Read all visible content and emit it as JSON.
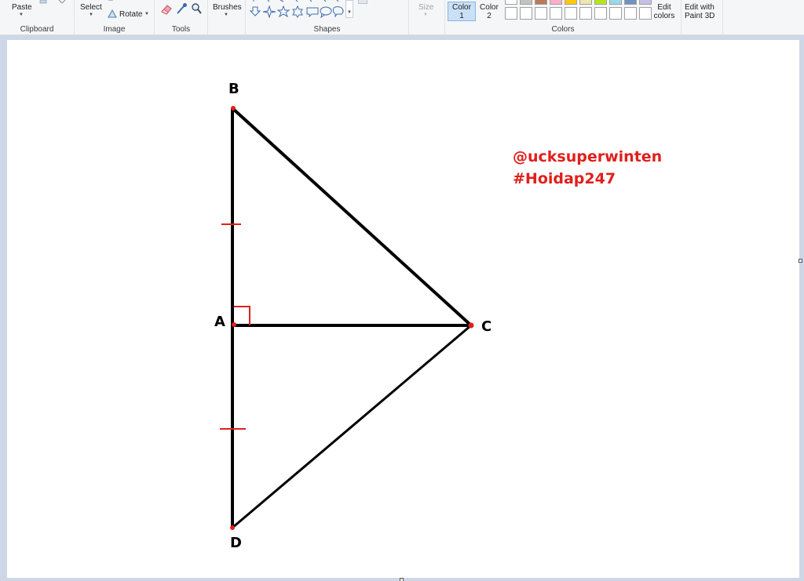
{
  "ribbon": {
    "clipboard": {
      "paste_label": "Paste",
      "group_label": "Clipboard"
    },
    "image": {
      "select_label": "Select",
      "rotate_label": "Rotate",
      "group_label": "Image"
    },
    "tools": {
      "group_label": "Tools",
      "icons": [
        "eraser-icon",
        "color-picker-icon",
        "magnifier-icon"
      ]
    },
    "brushes": {
      "label": "Brushes"
    },
    "shapes": {
      "group_label": "Shapes"
    },
    "size": {
      "label": "Size"
    },
    "colors": {
      "color1_line1": "Color",
      "color1_line2": "1",
      "color2_line1": "Color",
      "color2_line2": "2",
      "group_label": "Colors",
      "edit_line1": "Edit",
      "edit_line2": "colors",
      "top_row_colors": [
        "#ffffff",
        "#c3c3c3",
        "#b97a57",
        "#ffaec9",
        "#ffc90e",
        "#efe4b0",
        "#b5e61d",
        "#99d9ea",
        "#7092be",
        "#c8bfe7"
      ]
    },
    "paint3d": {
      "line1": "Edit with",
      "line2": "Paint 3D"
    }
  },
  "drawing": {
    "point_labels": {
      "a": "A",
      "b": "B",
      "c": "C",
      "d": "D"
    },
    "watermark_line1": "@ucksuperwinten",
    "watermark_line2": "#Hoidap247",
    "stroke_color": "#000000",
    "accent_color": "#e0201c"
  }
}
